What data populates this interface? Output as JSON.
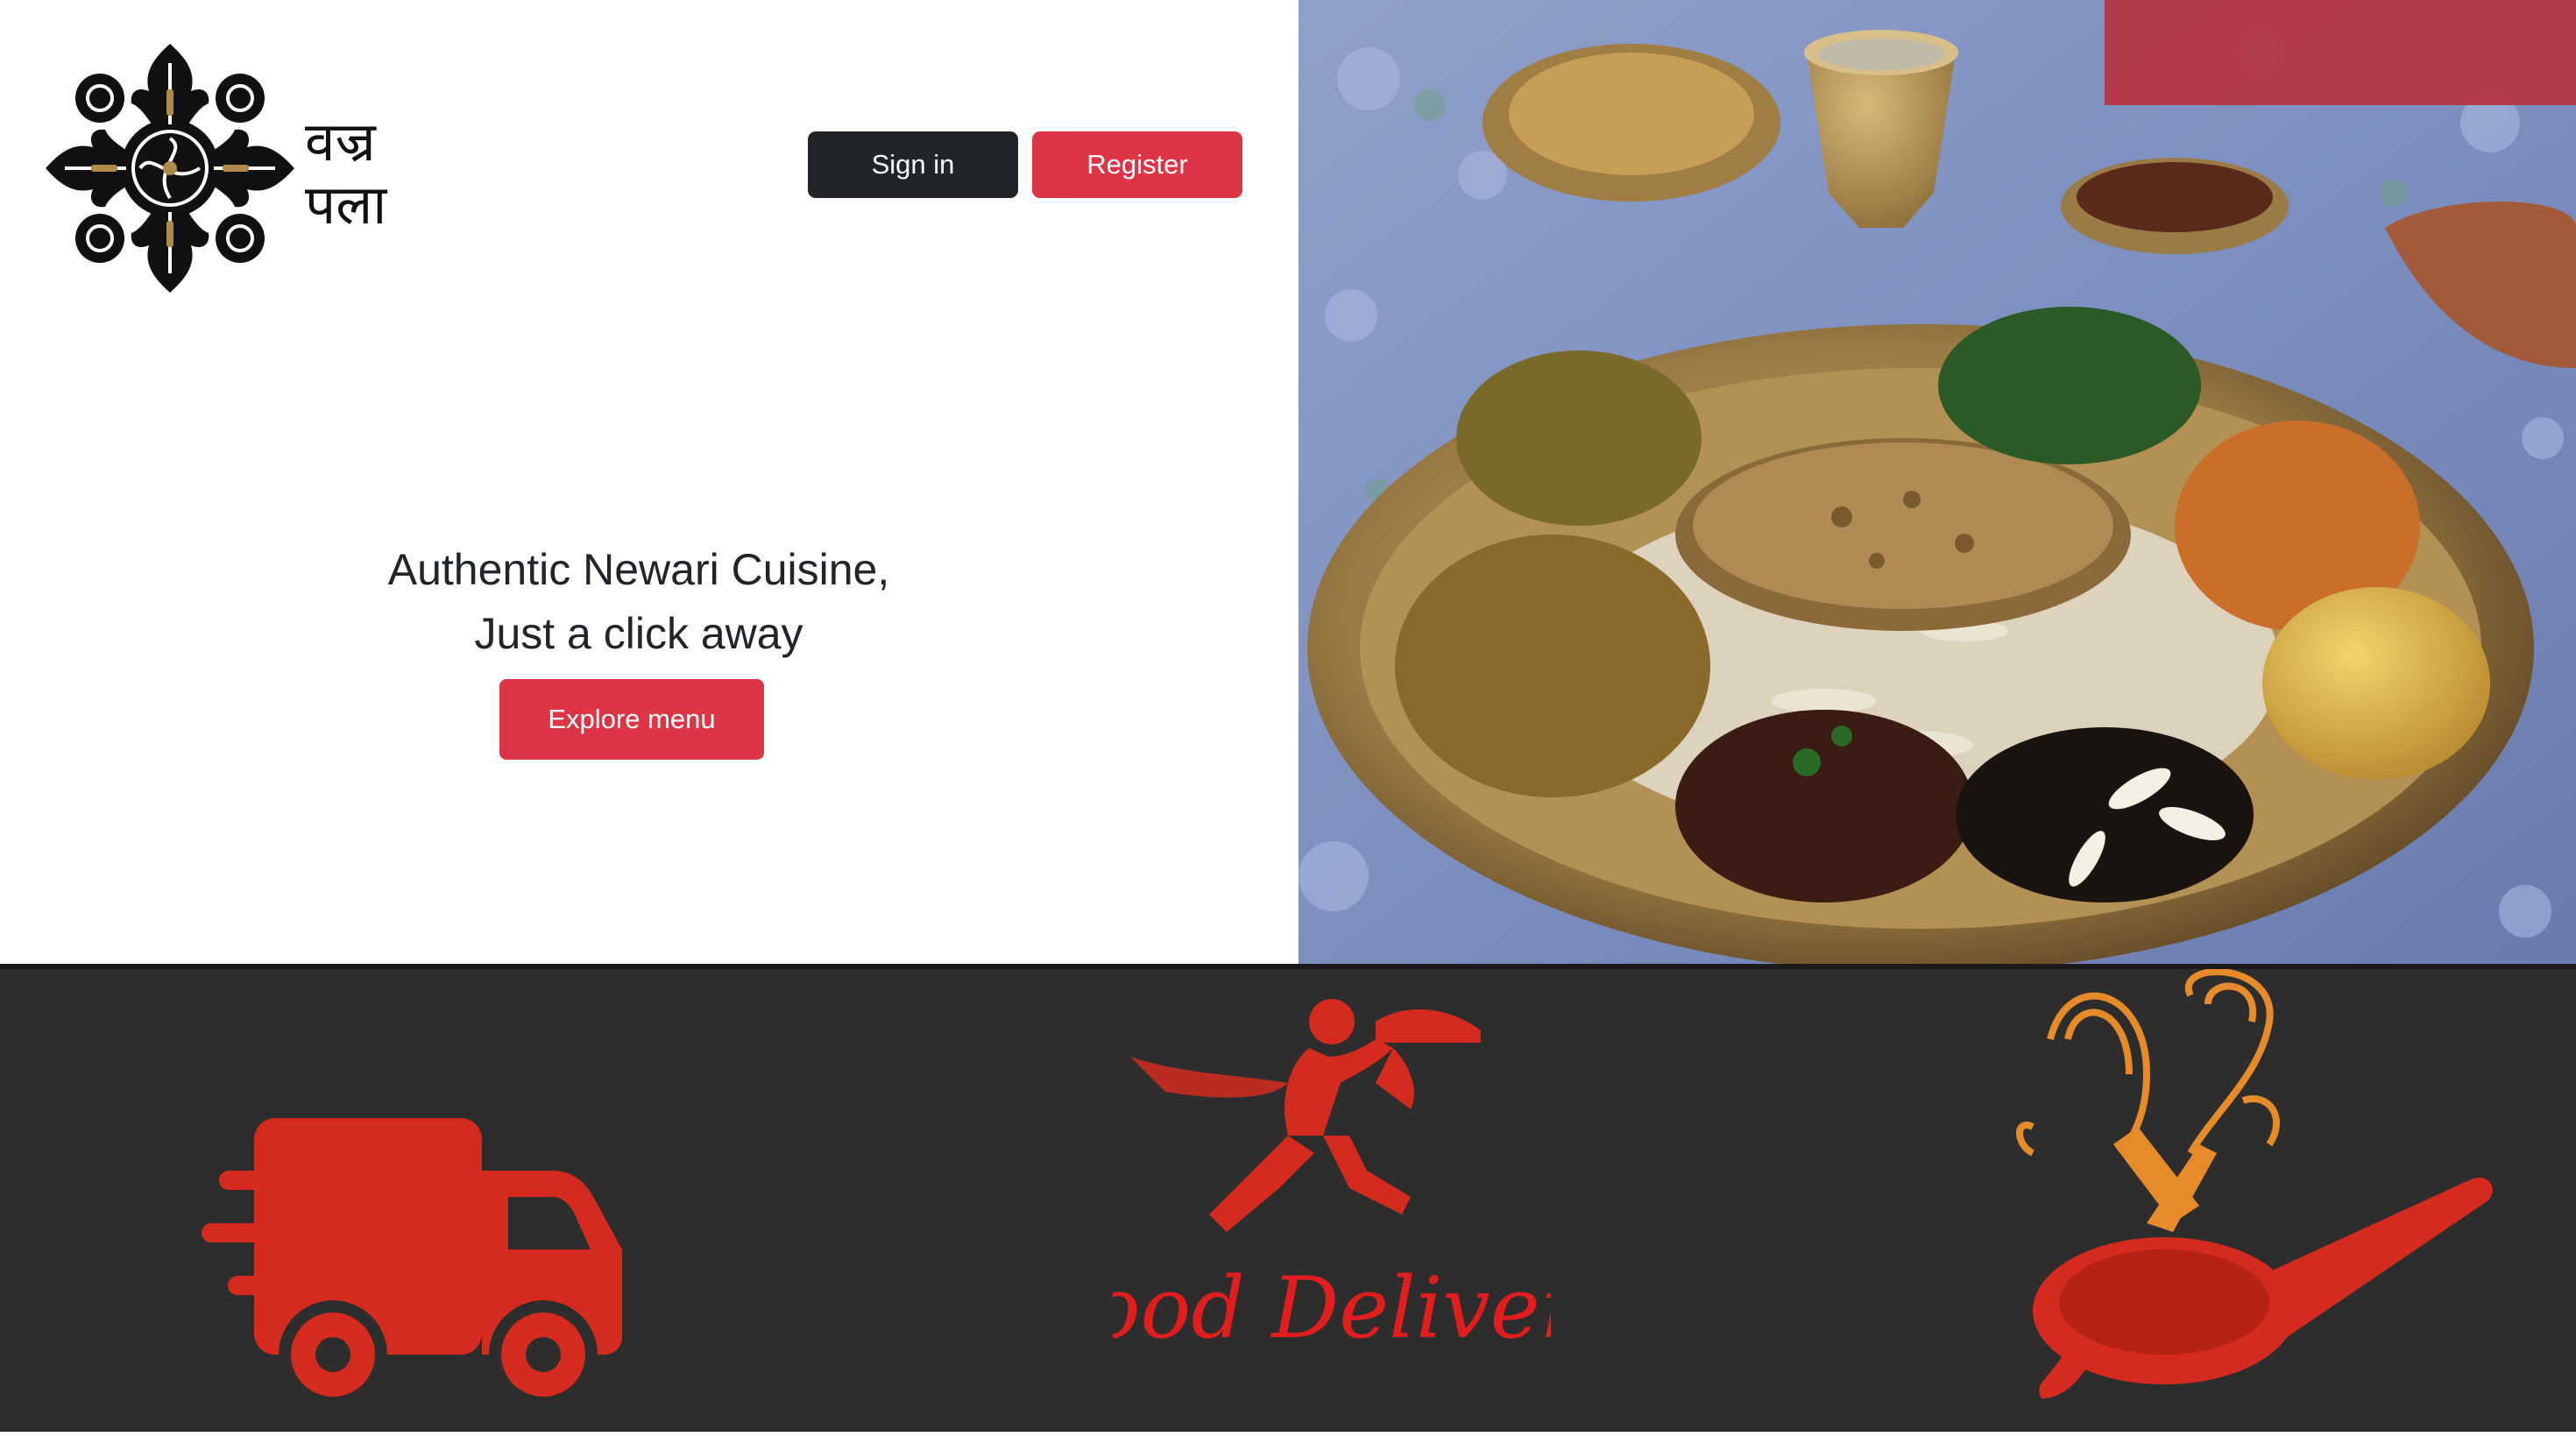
{
  "brand": {
    "logo_text": "वज्र\nपला",
    "logo_icon": "vajra-emblem-icon"
  },
  "header": {
    "sign_in_label": "Sign in",
    "register_label": "Register"
  },
  "hero": {
    "tagline_line1": "Authentic Newari Cuisine,",
    "tagline_line2": "Just a click away",
    "cta_label": "Explore menu",
    "photo": "newari-food-platter-image"
  },
  "features": [
    {
      "icon": "delivery-truck-icon"
    },
    {
      "icon": "food-delivery-runner-icon",
      "caption": "Food Delivery"
    },
    {
      "icon": "whisk-and-pan-icon"
    }
  ],
  "colors": {
    "primary_red": "#dc3545",
    "dark_button": "#212529",
    "icon_red": "#e21d1d",
    "features_background": "#2d2d2d",
    "whisk_orange": "#e78a2a"
  }
}
